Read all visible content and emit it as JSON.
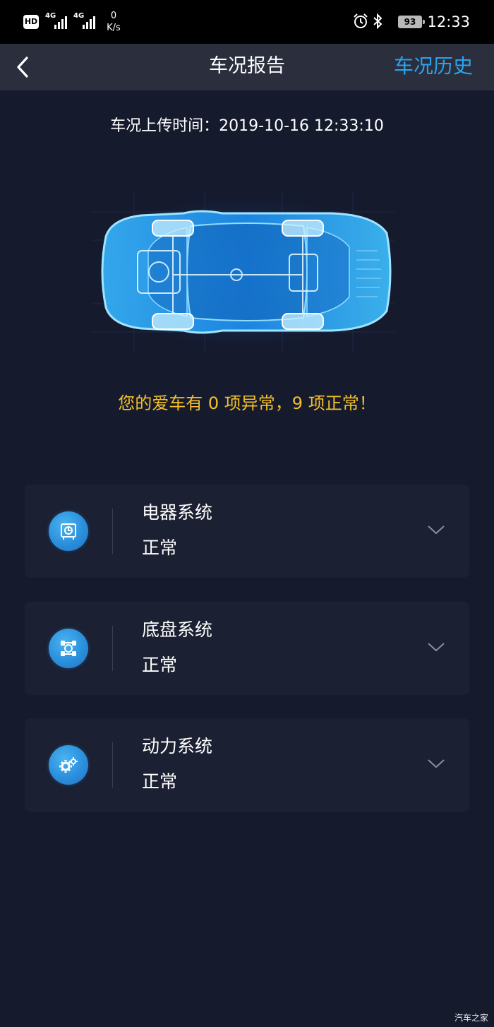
{
  "status_bar": {
    "hd": "HD",
    "signal_1": "4G",
    "signal_2": "4G",
    "speed_value": "0",
    "speed_unit": "K/s",
    "alarm_icon": "alarm-clock-icon",
    "bluetooth_icon": "bluetooth-icon",
    "battery": "93",
    "time": "12:33"
  },
  "nav": {
    "back_icon": "chevron-left-icon",
    "title": "车况报告",
    "history": "车况历史"
  },
  "upload_time": "车况上传时间：2019-10-16 12:33:10",
  "car_image": "car-xray-illustration",
  "summary": "您的爱车有 0 项异常，9 项正常！",
  "systems": [
    {
      "name": "电器系统",
      "status": "正常",
      "icon": "electrical-system-icon"
    },
    {
      "name": "底盘系统",
      "status": "正常",
      "icon": "chassis-system-icon"
    },
    {
      "name": "动力系统",
      "status": "正常",
      "icon": "power-system-gears-icon"
    }
  ],
  "watermark": "汽车之家",
  "colors": {
    "background": "#151a2d",
    "navbar": "#2a2e3d",
    "card": "#1b2032",
    "accent_blue": "#29a4f0",
    "summary_yellow": "#f4c02a"
  }
}
